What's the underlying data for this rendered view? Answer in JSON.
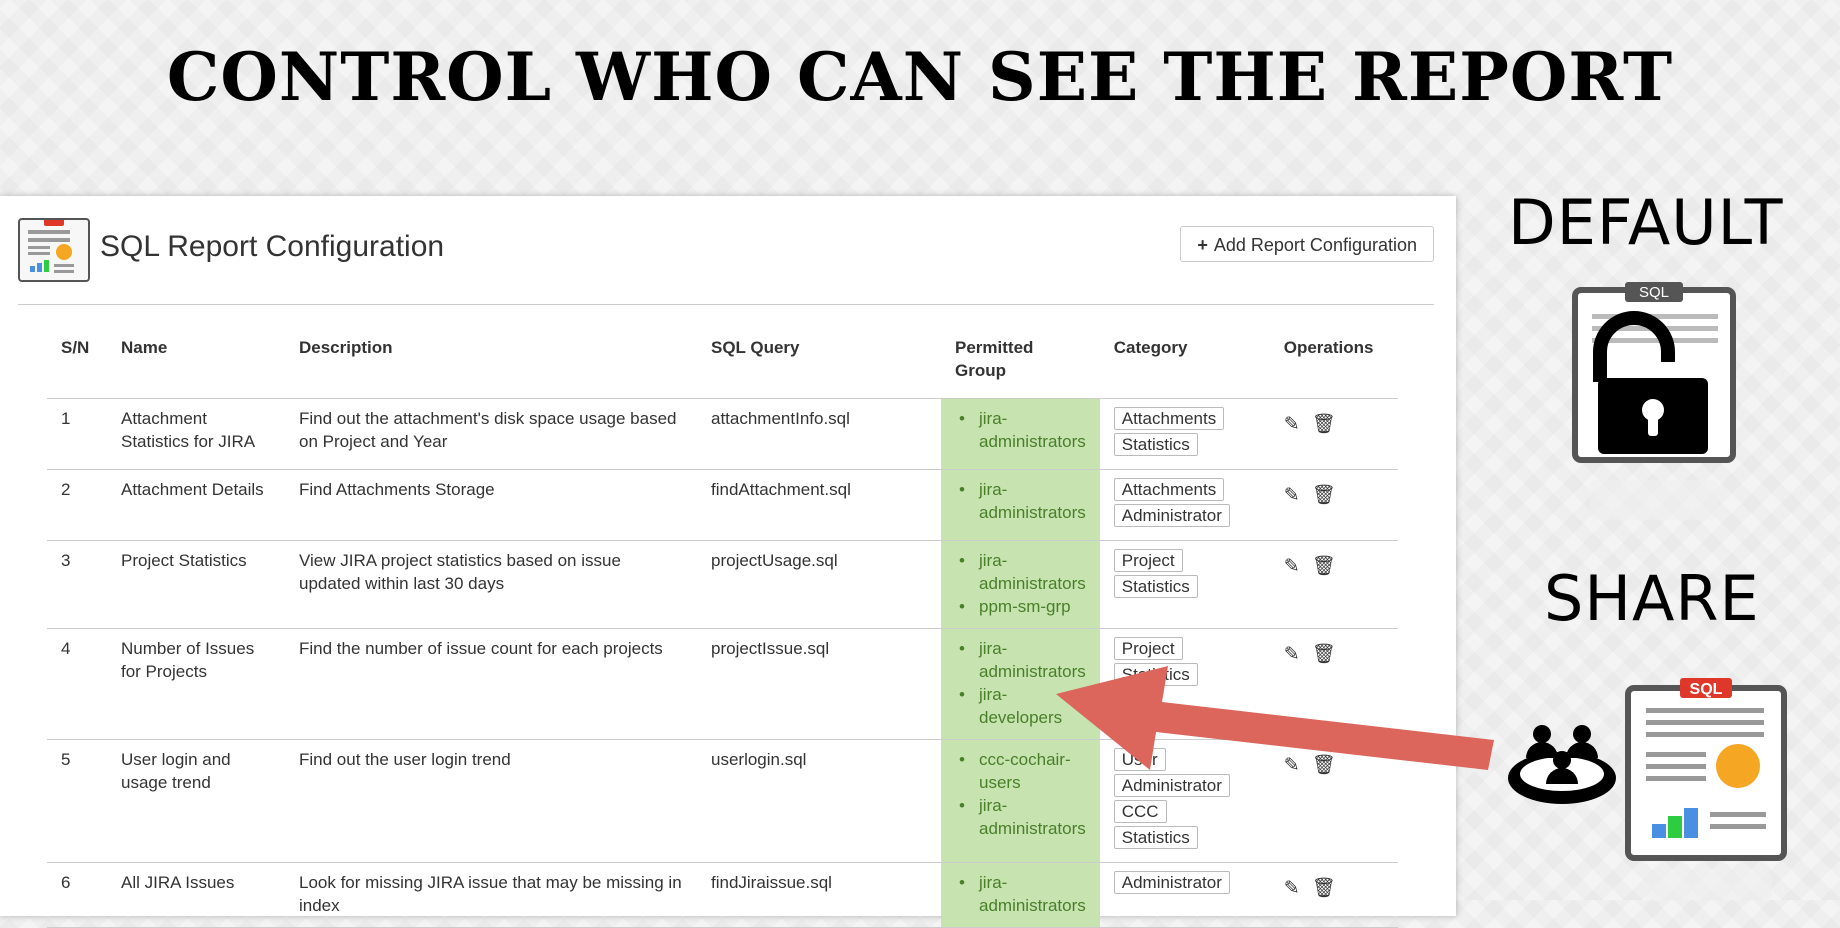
{
  "slide": {
    "title": "CONTROL WHO CAN SEE THE REPORT"
  },
  "panel": {
    "title": "SQL Report Configuration",
    "add_button": {
      "icon": "plus-icon",
      "label": "Add Report Configuration"
    }
  },
  "table": {
    "headers": [
      "S/N",
      "Name",
      "Description",
      "SQL Query",
      "Permitted Group",
      "Category",
      "Operations"
    ],
    "rows": [
      {
        "sn": "1",
        "name": "Attachment Statistics for JIRA",
        "description": "Find out the attachment's disk space usage based on Project and Year",
        "sql": "attachmentInfo.sql",
        "groups": [
          "jira-administrators"
        ],
        "categories": [
          "Attachments",
          "Statistics"
        ]
      },
      {
        "sn": "2",
        "name": "Attachment Details",
        "description": "Find Attachments Storage",
        "sql": "findAttachment.sql",
        "groups": [
          "jira-administrators"
        ],
        "categories": [
          "Attachments",
          "Administrator"
        ]
      },
      {
        "sn": "3",
        "name": "Project Statistics",
        "description": "View JIRA project statistics based on issue updated within last 30 days",
        "sql": "projectUsage.sql",
        "groups": [
          "jira-administrators",
          "ppm-sm-grp"
        ],
        "categories": [
          "Project",
          "Statistics"
        ]
      },
      {
        "sn": "4",
        "name": "Number of Issues for Projects",
        "description": "Find the number of issue count for each projects",
        "sql": "projectIssue.sql",
        "groups": [
          "jira-administrators",
          "jira-developers"
        ],
        "categories": [
          "Project",
          "Statistics"
        ]
      },
      {
        "sn": "5",
        "name": "User login and usage trend",
        "description": "Find out the user login trend",
        "sql": "userlogin.sql",
        "groups": [
          "ccc-cochair-users",
          "jira-administrators"
        ],
        "categories": [
          "User",
          "Administrator",
          "CCC",
          "Statistics"
        ]
      },
      {
        "sn": "6",
        "name": "All JIRA Issues",
        "description": "Look for missing JIRA issue that may be missing in index",
        "sql": "findJiraissue.sql",
        "groups": [
          "jira-administrators"
        ],
        "categories": [
          "Administrator"
        ]
      }
    ],
    "op_icons": [
      "pencil-icon",
      "trash-icon"
    ]
  },
  "side": {
    "default_label": "DEFAULT",
    "share_label": "SHARE",
    "sql_badge": "SQL"
  },
  "colors": {
    "permitted_group_bg": "#c6e3b0",
    "arrow": "#dc665c",
    "sql_badge": "#e0372b"
  }
}
